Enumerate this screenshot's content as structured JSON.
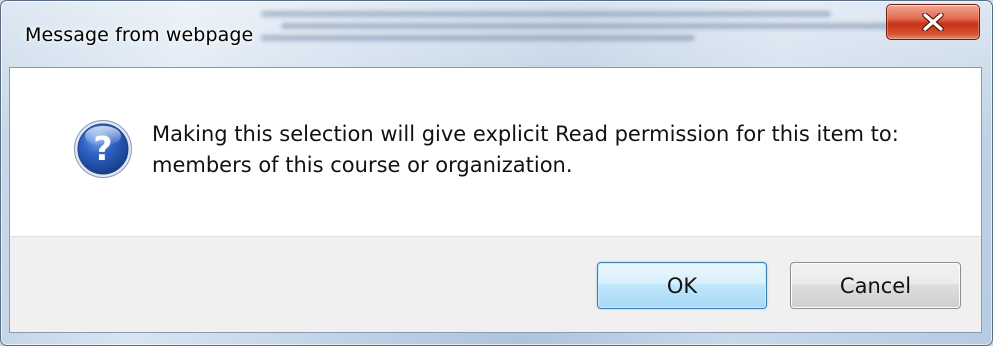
{
  "window": {
    "title": "Message from webpage",
    "close_icon": "close-x-icon"
  },
  "dialog": {
    "icon": "question-icon",
    "message_line1": "Making this selection will give explicit Read permission for this item to:",
    "message_line2": "members of this course or organization."
  },
  "buttons": {
    "ok_label": "OK",
    "cancel_label": "Cancel"
  },
  "colors": {
    "close_button": "#c6341b",
    "ok_border": "#3c7fb1",
    "button_area_bg": "#f0f0f0",
    "icon_blue": "#2050a8"
  }
}
